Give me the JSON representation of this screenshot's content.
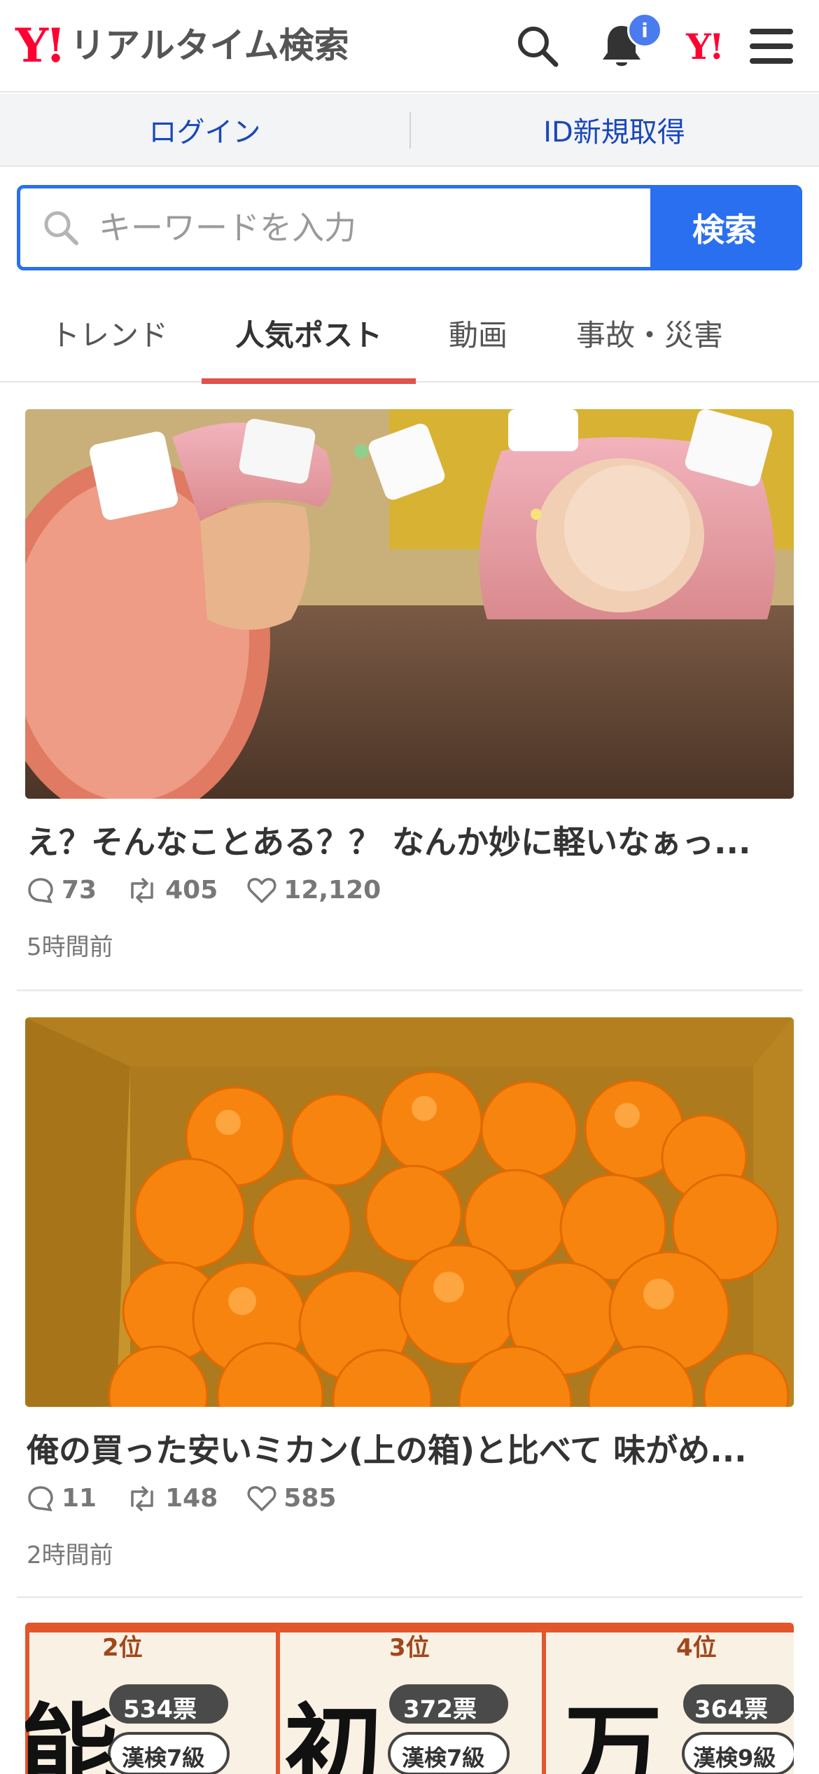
{
  "header": {
    "logo_mark": "Y!",
    "logo_title": "リアルタイム検索",
    "notification_badge": "i",
    "yahoo_mark": "Y!"
  },
  "login_bar": {
    "login_label": "ログイン",
    "register_label": "ID新規取得"
  },
  "search": {
    "placeholder": "キーワードを入力",
    "button_label": "検索"
  },
  "tabs": [
    {
      "label": "トレンド",
      "active": false
    },
    {
      "label": "人気ポスト",
      "active": true
    },
    {
      "label": "動画",
      "active": false
    },
    {
      "label": "事故・災害",
      "active": false
    }
  ],
  "posts": [
    {
      "title": "え？そんなことある？？ なんか妙に軽いなぁっ...",
      "replies": "73",
      "reposts": "405",
      "likes": "12,120",
      "time": "5時間前",
      "image": "photo of pink cream puffs cut open, hollow inside"
    },
    {
      "title": "俺の買った安いミカン(上の箱)と比べて 味がめ...",
      "replies": "11",
      "reposts": "148",
      "likes": "585",
      "time": "2時間前",
      "image": "photo of a cardboard box full of mandarin oranges"
    },
    {
      "ranks": [
        "2位",
        "3位",
        "4位"
      ],
      "kanji": [
        "能",
        "初",
        "万"
      ],
      "counts": [
        "534票",
        "372票",
        "364票"
      ],
      "levels": [
        "漢検7級",
        "漢検7級",
        "漢検9級"
      ]
    }
  ],
  "colors": {
    "brand_red": "#ff0033",
    "accent_blue": "#2a6ff0",
    "link_blue": "#1948b8",
    "active_tab_underline": "#e0524a"
  }
}
